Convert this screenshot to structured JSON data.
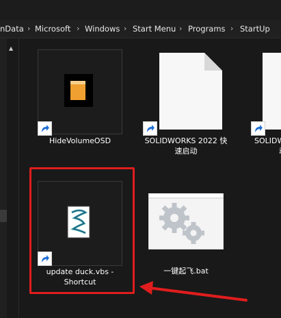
{
  "breadcrumb": {
    "items": [
      "nData",
      "Microsoft",
      "Windows",
      "Start Menu",
      "Programs",
      "StartUp"
    ],
    "separator": "›"
  },
  "files": [
    {
      "name": "HideVolumeOSD",
      "icon": "volume-app-icon"
    },
    {
      "name_line1": "SOLIDWORKS 2022 快",
      "name_line2": "速启动",
      "icon": "document-icon"
    },
    {
      "name_line1": "SOLIDWORKS",
      "name_line2": "动",
      "icon": "document-icon"
    },
    {
      "name_line1": "update duck.vbs -",
      "name_line2": "Shortcut",
      "icon": "vbscript-icon"
    },
    {
      "name": "一键起飞.bat",
      "icon": "batch-gears-icon"
    }
  ],
  "colors": {
    "highlight": "#e01d1d",
    "background": "#191919"
  }
}
